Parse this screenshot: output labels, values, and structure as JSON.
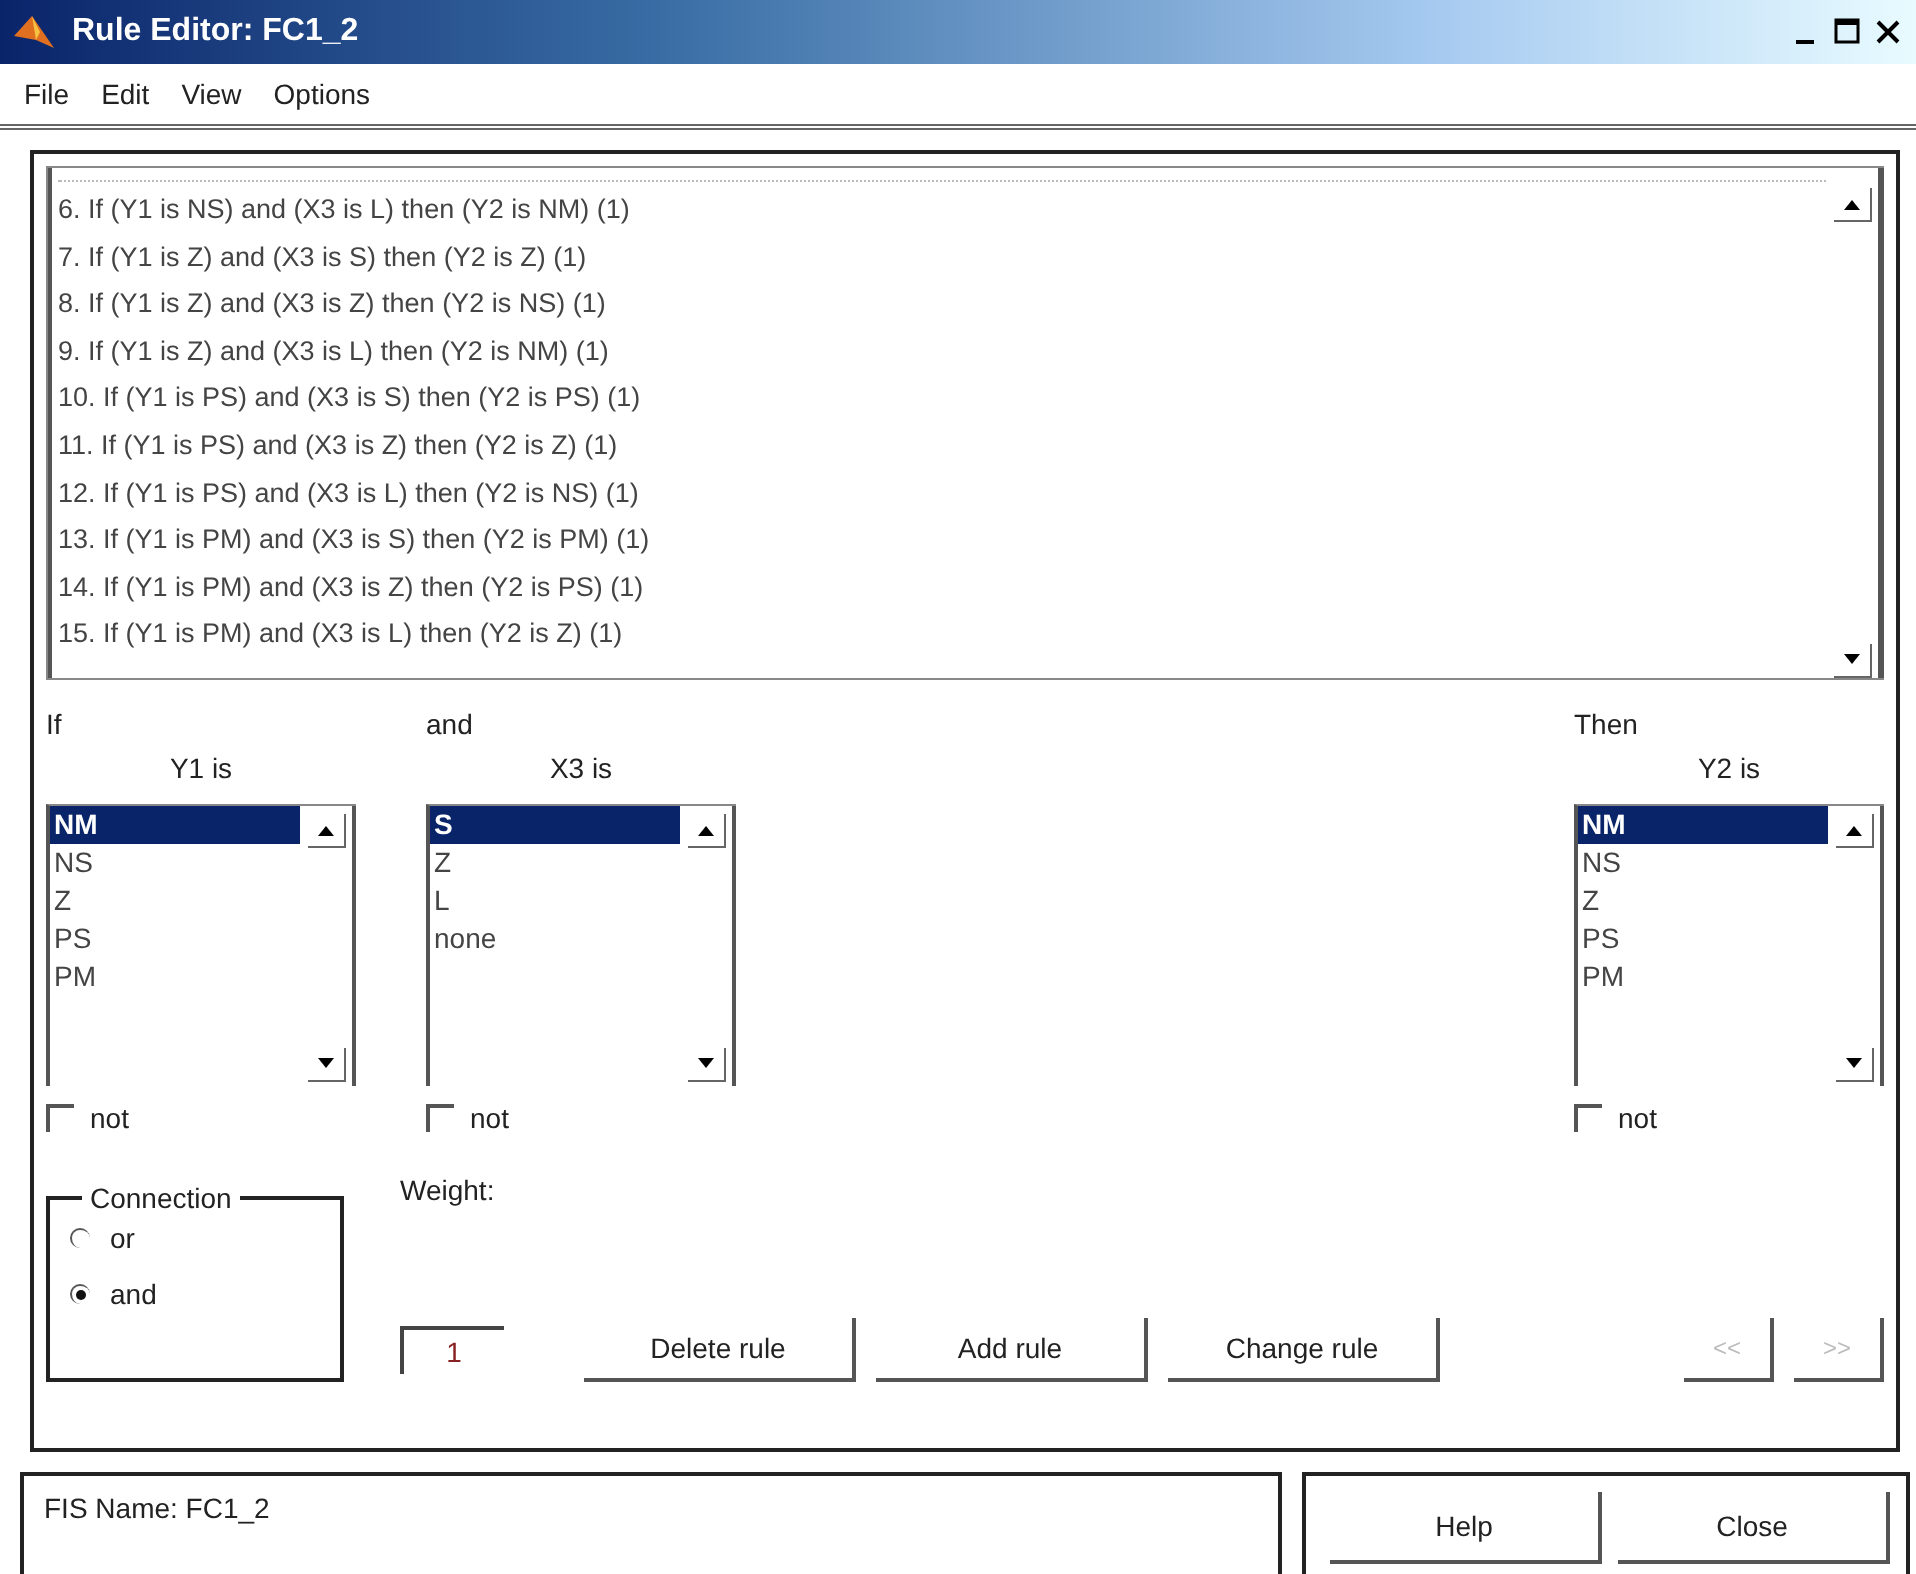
{
  "window": {
    "title": "Rule Editor: FC1_2"
  },
  "menu": [
    "File",
    "Edit",
    "View",
    "Options"
  ],
  "rules": [
    "6. If (Y1 is NS) and (X3 is L) then (Y2 is NM) (1)",
    "7. If (Y1 is Z) and (X3 is S) then (Y2 is Z) (1)",
    "8. If (Y1 is Z) and (X3 is Z) then (Y2 is NS) (1)",
    "9. If (Y1 is Z) and (X3 is L) then (Y2 is NM) (1)",
    "10. If (Y1 is PS) and (X3 is S) then (Y2 is PS) (1)",
    "11. If (Y1 is PS) and (X3 is Z) then (Y2 is Z) (1)",
    "12. If (Y1 is PS) and (X3 is L) then (Y2 is NS) (1)",
    "13. If (Y1 is PM) and (X3 is S) then (Y2 is PM) (1)",
    "14. If (Y1 is PM) and (X3 is Z) then (Y2 is PS) (1)",
    "15. If (Y1 is PM) and (X3 is L) then (Y2 is Z) (1)"
  ],
  "variables": [
    {
      "heading": "If",
      "label": "Y1 is",
      "not_label": "not",
      "not_checked": false,
      "items": [
        {
          "label": "NM",
          "selected": true
        },
        {
          "label": "NS",
          "selected": false
        },
        {
          "label": "Z",
          "selected": false
        },
        {
          "label": "PS",
          "selected": false
        },
        {
          "label": "PM",
          "selected": false
        }
      ]
    },
    {
      "heading": "and",
      "label": "X3 is",
      "not_label": "not",
      "not_checked": false,
      "items": [
        {
          "label": "S",
          "selected": true
        },
        {
          "label": "Z",
          "selected": false
        },
        {
          "label": "L",
          "selected": false
        },
        {
          "label": "none",
          "selected": false
        }
      ]
    },
    {
      "heading": "Then",
      "label": "Y2 is",
      "not_label": "not",
      "not_checked": false,
      "items": [
        {
          "label": "NM",
          "selected": true
        },
        {
          "label": "NS",
          "selected": false
        },
        {
          "label": "Z",
          "selected": false
        },
        {
          "label": "PS",
          "selected": false
        },
        {
          "label": "PM",
          "selected": false
        }
      ]
    }
  ],
  "connection": {
    "title": "Connection",
    "options": [
      {
        "label": "or",
        "selected": false
      },
      {
        "label": "and",
        "selected": true
      }
    ]
  },
  "weight": {
    "label": "Weight:",
    "value": "1"
  },
  "rule_buttons": [
    "Delete rule",
    "Add rule",
    "Change rule"
  ],
  "nav_buttons": [
    {
      "label": "<<",
      "disabled": true
    },
    {
      "label": ">>",
      "disabled": true
    }
  ],
  "status": "FIS Name: FC1_2",
  "footer_buttons": [
    "Help",
    "Close"
  ]
}
